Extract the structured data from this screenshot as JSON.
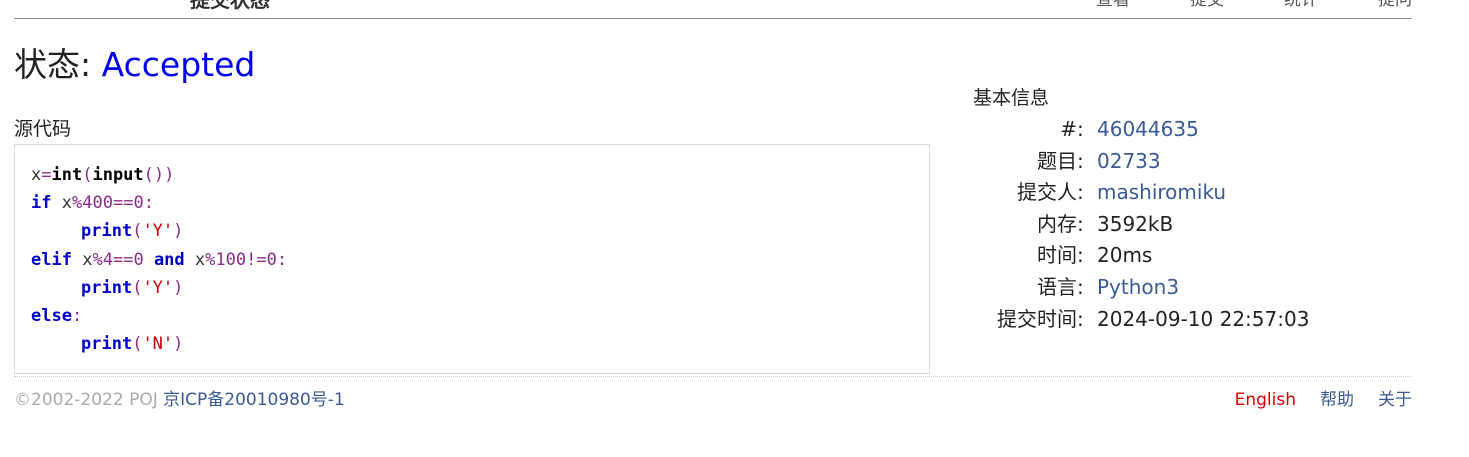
{
  "header": {
    "site_title": "提交状态",
    "nav": [
      "查看",
      "提交",
      "统计",
      "提问"
    ]
  },
  "status": {
    "label": "状态: ",
    "value": "Accepted"
  },
  "source": {
    "heading": "源代码",
    "code": [
      "x=int(input())",
      "if x%400==0:",
      "    print('Y')",
      "elif x%4==0 and x%100!=0:",
      "    print('Y')",
      "else:",
      "    print('N')"
    ]
  },
  "info": {
    "heading": "基本信息",
    "rows": [
      {
        "label": "#",
        "value": "46044635",
        "link": true
      },
      {
        "label": "题目",
        "value": "02733",
        "link": true
      },
      {
        "label": "提交人",
        "value": "mashiromiku",
        "link": true
      },
      {
        "label": "内存",
        "value": "3592kB",
        "link": false
      },
      {
        "label": "时间",
        "value": "20ms",
        "link": false
      },
      {
        "label": "语言",
        "value": "Python3",
        "link": true
      },
      {
        "label": "提交时间",
        "value": "2024-09-10 22:57:03",
        "link": false
      }
    ],
    "separator": ":"
  },
  "footer": {
    "copyright": "©2002-2022 POJ ",
    "icp": "京ICP备20010980号-1",
    "links": {
      "english": "English",
      "help": "帮助",
      "about": "关于"
    }
  },
  "colors": {
    "accepted": "#0000ee",
    "link": "#3a5a96",
    "keyword": "#0000cc",
    "string": "#cc0000",
    "number": "#8a2b8a",
    "english_link": "#dd0000"
  }
}
